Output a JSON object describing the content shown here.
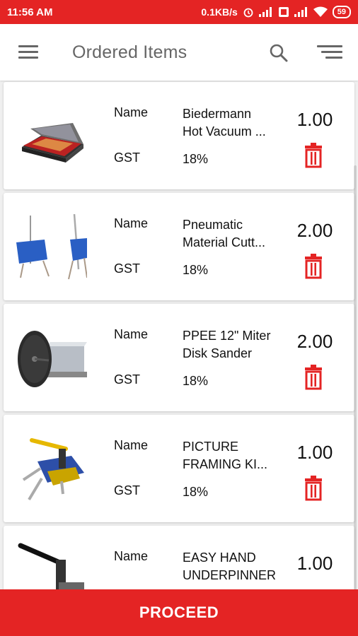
{
  "status_bar": {
    "time": "11:56 AM",
    "net_speed": "0.1KB/s",
    "battery": "59"
  },
  "app_bar": {
    "title": "Ordered Items"
  },
  "labels": {
    "name": "Name",
    "gst": "GST"
  },
  "items": [
    {
      "name": "Biedermann Hot Vacuum ...",
      "gst": "18%",
      "qty": "1.00",
      "image": "vacuum-press-image"
    },
    {
      "name": "Pneumatic Material Cutt...",
      "gst": "18%",
      "qty": "2.00",
      "image": "material-cutter-image"
    },
    {
      "name": "PPEE 12\" Miter Disk Sander",
      "gst": "18%",
      "qty": "2.00",
      "image": "disk-sander-image"
    },
    {
      "name": "PICTURE FRAMING KI...",
      "gst": "18%",
      "qty": "1.00",
      "image": "framing-kit-image"
    },
    {
      "name": "EASY HAND UNDERPINNER",
      "gst": "",
      "qty": "1.00",
      "image": "underpinner-image"
    }
  ],
  "footer": {
    "proceed_label": "PROCEED"
  },
  "colors": {
    "accent": "#e42424",
    "delete": "#e42424"
  }
}
